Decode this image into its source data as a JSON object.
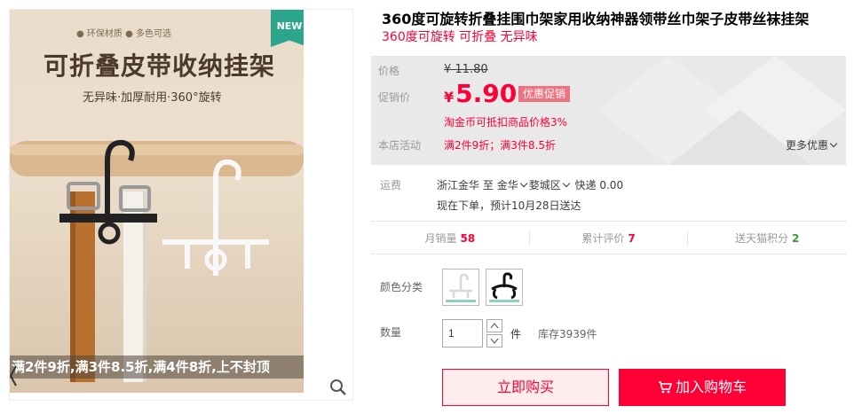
{
  "gallery": {
    "image_tags": "● 环保材质 ● 多色可选",
    "image_headline": "可折叠皮带收纳挂架",
    "image_subline": "无异味·加厚耐用·360°旋转",
    "new_badge": "NEW",
    "promo_strip": "满2件9折,满3件8.5折,满4件8折,上不封顶"
  },
  "product": {
    "title": "360度可旋转折叠挂围巾架家用收纳神器领带丝巾架子皮带丝袜挂架",
    "subtitle": "360度可旋转 可折叠 无异味"
  },
  "price": {
    "original_label": "价格",
    "original_value": "¥ 11.80",
    "sale_label": "促销价",
    "currency": "¥",
    "sale_value": "5.90",
    "sale_tag": "优惠促销",
    "coin_note": "淘金币可抵扣商品价格3%",
    "store_label": "本店活动",
    "store_value": "满2件9折；满3件8.5折",
    "more_label": "更多优惠"
  },
  "shipping": {
    "label": "运费",
    "from": "浙江金华",
    "to_word": "至",
    "city": "金华",
    "district": "婺城区",
    "method": "快递 0.00",
    "eta": "现在下单，预计10月28日送达"
  },
  "stats": [
    {
      "label": "月销量",
      "value": "58",
      "color": "#ff0036"
    },
    {
      "label": "累计评价",
      "value": "7",
      "color": "#ff0036"
    },
    {
      "label": "送天猫积分",
      "value": "2",
      "color": "#339933"
    }
  ],
  "options": {
    "color_label": "颜色分类",
    "swatches": [
      "white-hanger",
      "black-hanger"
    ]
  },
  "quantity": {
    "label": "数量",
    "value": "1",
    "unit": "件",
    "stock": "库存3939件"
  },
  "actions": {
    "buy_now": "立即购买",
    "add_to_cart": "加入购物车"
  },
  "colors": {
    "accent": "#ff0036",
    "badge_green": "#2ca58d",
    "price_bg": "#e9e9e9"
  }
}
